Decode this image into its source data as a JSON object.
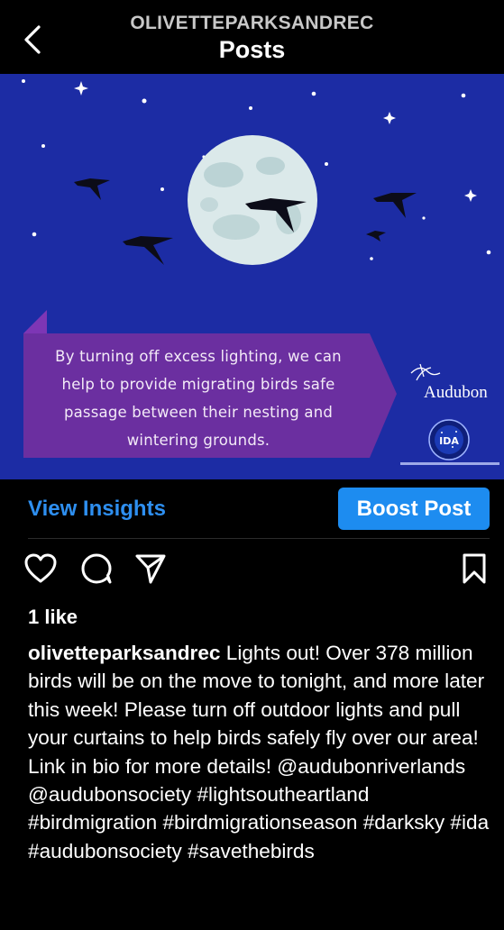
{
  "header": {
    "account_name": "OLIVETTEPARKSANDREC",
    "title": "Posts",
    "back_icon": "chevron-left-icon"
  },
  "post_image": {
    "banner_text_lines": [
      "By turning off excess lighting, we can",
      "help to provide migrating birds safe",
      "passage between their nesting and",
      "wintering grounds."
    ],
    "audubon_logo_text": "Audubon",
    "ida_logo_text": "IDA",
    "colors": {
      "sky": "#1c2ca4",
      "banner": "#6b2fa0",
      "moon": "#dbe9ea"
    }
  },
  "actions": {
    "view_insights_label": "View Insights",
    "boost_label": "Boost Post",
    "accent_color": "#1d8cf0"
  },
  "icons": {
    "like": "heart-icon",
    "comment": "comment-icon",
    "share": "send-icon",
    "save": "bookmark-icon"
  },
  "likes_text": "1 like",
  "caption": {
    "username": "olivetteparksandrec",
    "text": " Lights out! Over 378 million birds will be on the move to tonight, and more later this week! Please turn off outdoor lights and pull your curtains to help birds safely fly over our area! Link in bio for more details! @audubonriverlands @audubonsociety #lightsoutheartland #birdmigration #birdmigrationseason #darksky #ida #audubonsociety #savethebirds"
  }
}
